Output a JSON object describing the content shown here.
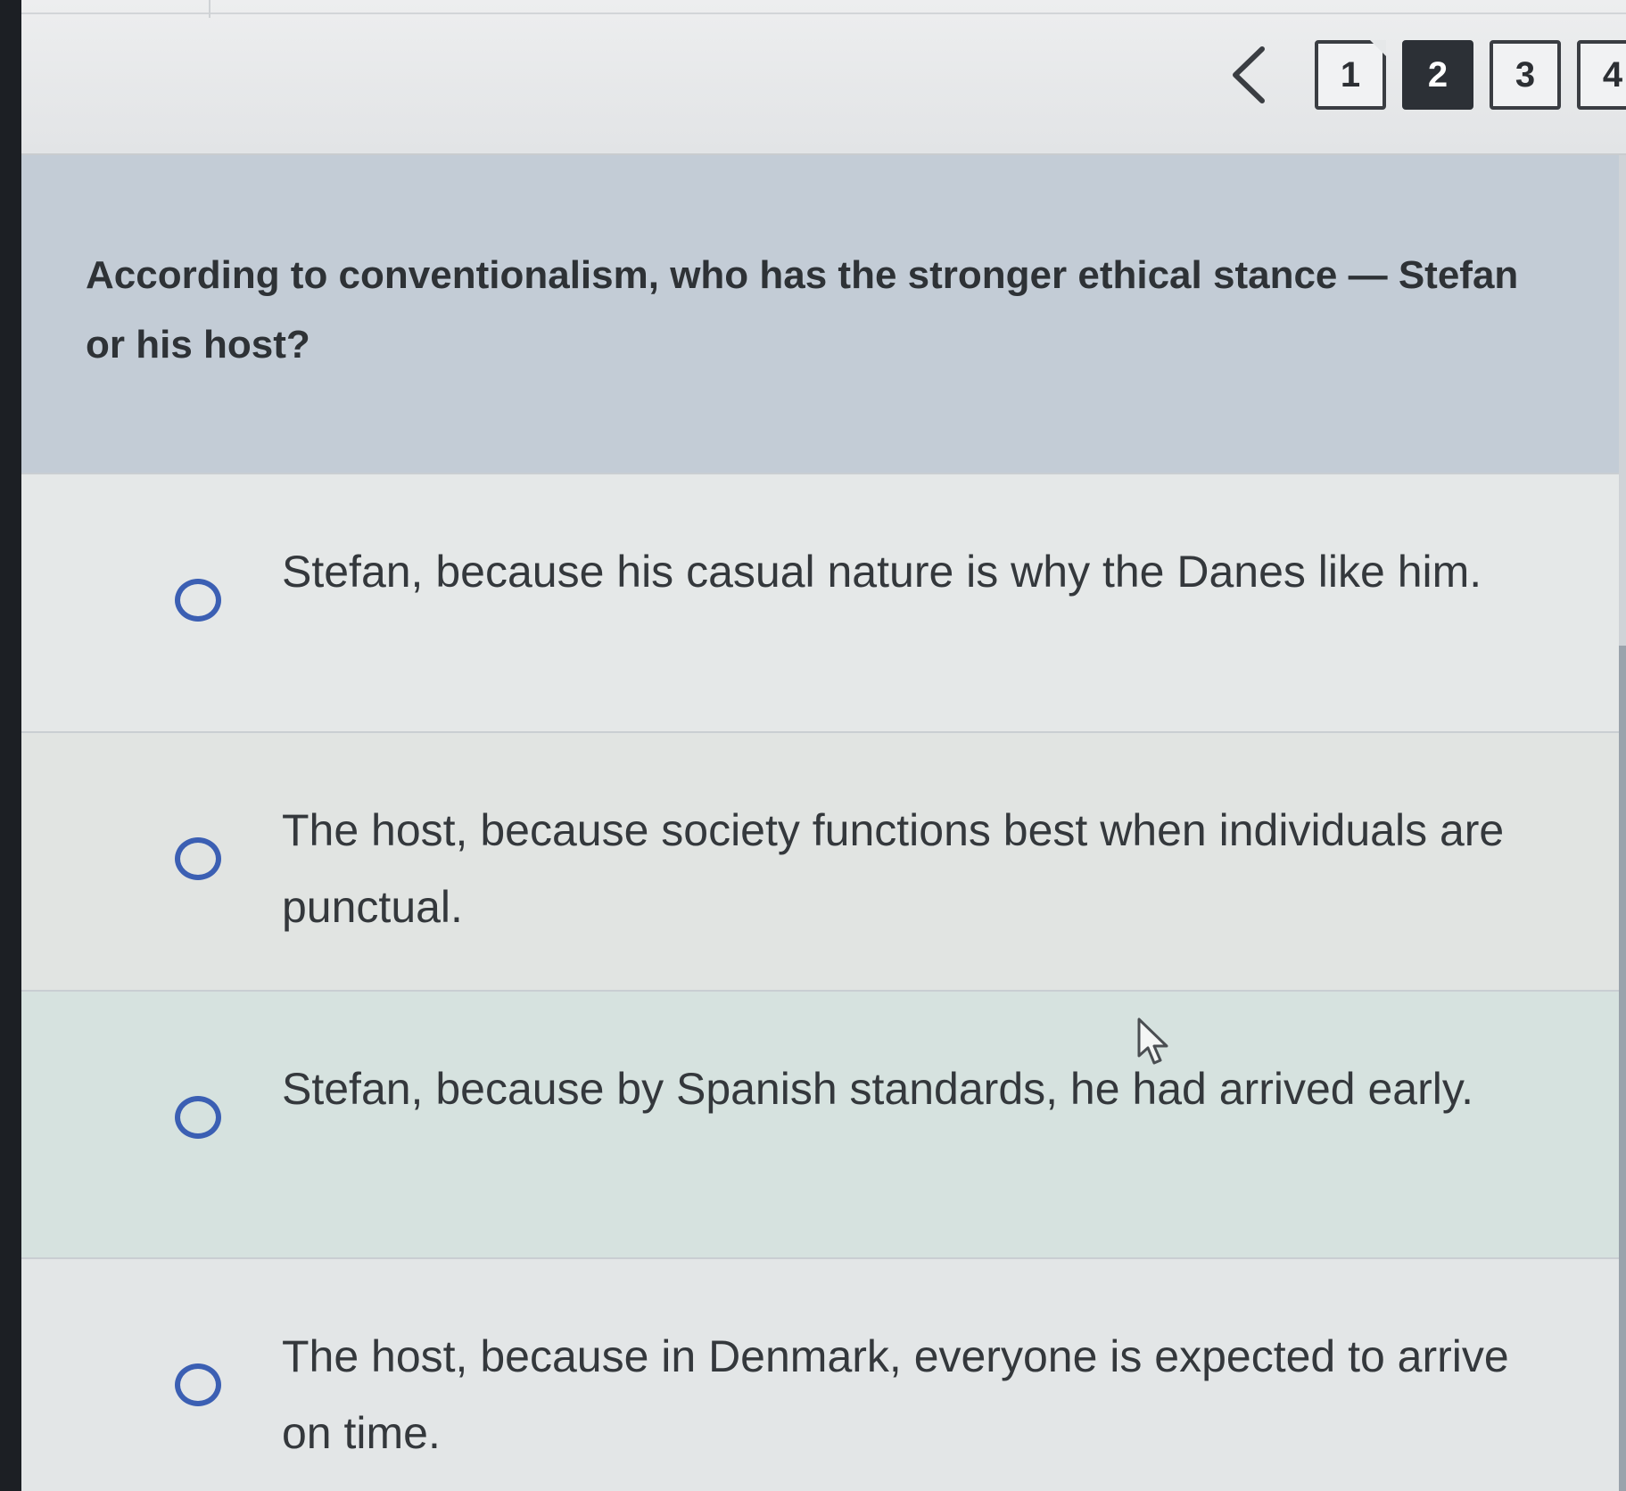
{
  "pager": {
    "prev_icon": "chevron-left-icon",
    "pages": [
      {
        "label": "1",
        "state": "default"
      },
      {
        "label": "2",
        "state": "current"
      },
      {
        "label": "3",
        "state": "default"
      },
      {
        "label": "4",
        "state": "default"
      }
    ]
  },
  "question": {
    "text": "According to conventionalism, who has the stronger ethical stance — Stefan or his host?"
  },
  "answers": [
    {
      "text": "Stefan, because his casual nature is why the Danes like him."
    },
    {
      "text": "The host, because society functions best when individuals are punctual."
    },
    {
      "text": "Stefan, because by Spanish standards, he had arrived early."
    },
    {
      "text": "The host, because in Denmark, everyone is expected to arrive on time."
    }
  ],
  "colors": {
    "radio": "#3b5fb3",
    "question_bg": "#c3ccd6",
    "current_page_bg": "#2c3036"
  }
}
